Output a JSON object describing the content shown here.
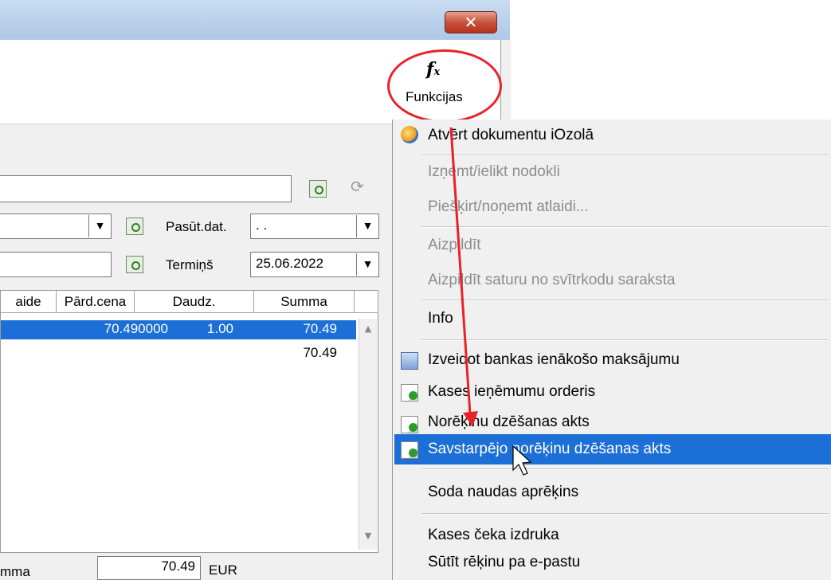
{
  "window": {
    "close_label": "✕"
  },
  "toolbar": {
    "functions_icon": "fx-icon",
    "functions_label": "Funkcijas"
  },
  "form": {
    "order_date_label": "Pasūt.dat.",
    "order_date_value": ". .",
    "due_label": "Termiņš",
    "due_value": "25.06.2022"
  },
  "grid": {
    "columns": [
      "aide",
      "Pārd.cena",
      "Daudz.",
      "Summa"
    ],
    "rows": [
      {
        "price": "70.490000",
        "qty": "1.00",
        "sum": "70.49"
      }
    ],
    "total": "70.49"
  },
  "footer": {
    "sum_label": "mma",
    "sum_value": "70.49",
    "currency": "EUR"
  },
  "menu": {
    "items": [
      {
        "label": "Atvērt dokumentu iOzolā",
        "enabled": true,
        "icon": "ozols-icon"
      },
      {
        "label": "Izņemt/ielikt nodokli",
        "enabled": false
      },
      {
        "label": "Piešķirt/noņemt atlaidi...",
        "enabled": false
      },
      {
        "label": "Aizpildīt",
        "enabled": false
      },
      {
        "label": "Aizpildīt saturu no svītrkodu saraksta",
        "enabled": false
      },
      {
        "label": "Info",
        "enabled": true
      },
      {
        "label": "Izveidot bankas ienākošo maksājumu",
        "enabled": true,
        "icon": "bank-payment-icon"
      },
      {
        "label": "Kases ieņēmumu orderis",
        "enabled": true,
        "icon": "new-document-icon"
      },
      {
        "label": "Norēķinu dzēšanas akts",
        "enabled": true,
        "icon": "new-document-icon"
      },
      {
        "label": "Savstarpējo norēķinu dzēšanas akts",
        "enabled": true,
        "icon": "new-document-icon",
        "highlighted": true
      },
      {
        "label": "Soda naudas aprēķins",
        "enabled": true
      },
      {
        "label": "Kases čeka izdruka",
        "enabled": true
      },
      {
        "label": "Sūtīt rēķinu pa e-pastu",
        "enabled": true
      }
    ]
  },
  "colors": {
    "highlight": "#1b6fd6",
    "annotation": "#e8222a",
    "disabled_text": "#8d8d8d"
  }
}
